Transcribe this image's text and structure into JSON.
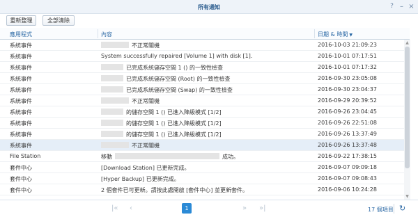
{
  "window": {
    "title": "所有通知",
    "help_icon": "?",
    "minimize_icon": "–",
    "close_icon": "×"
  },
  "toolbar": {
    "reorganize_label": "重新整理",
    "clear_all_label": "全部清除"
  },
  "columns": {
    "app": "應用程式",
    "content": "內容",
    "time": "日期 & 時間",
    "sort_icon": "▼"
  },
  "rows": [
    {
      "app": "系統事件",
      "content": "不正常關機",
      "redacted": "w40",
      "time": "2016-10-03 21:09:23"
    },
    {
      "app": "系統事件",
      "content": "System successfully repaired [Volume 1] with disk [1].",
      "redacted": "",
      "time": "2016-10-01 07:17:51"
    },
    {
      "app": "系統事件",
      "content": "已完成系統儲存空間 1 () 的一致性檢查",
      "redacted": "w32",
      "time": "2016-10-01 07:17:32"
    },
    {
      "app": "系統事件",
      "content": "已完成系統儲存空間 (Root) 的一致性檢查",
      "redacted": "w32",
      "time": "2016-09-30 23:05:08"
    },
    {
      "app": "系統事件",
      "content": "已完成系統儲存空間 (Swap) 的一致性檢查",
      "redacted": "w32",
      "time": "2016-09-30 23:04:37"
    },
    {
      "app": "系統事件",
      "content": "不正常關機",
      "redacted": "w40",
      "time": "2016-09-29 20:39:52"
    },
    {
      "app": "系統事件",
      "content": "的儲存空間 1 () 已進入降級模式 [1/2]",
      "redacted": "w32",
      "time": "2016-09-26 23:04:45"
    },
    {
      "app": "系統事件",
      "content": "的儲存空間 1 () 已進入降級模式 [1/2]",
      "redacted": "w32",
      "time": "2016-09-26 22:51:08"
    },
    {
      "app": "系統事件",
      "content": "的儲存空間 1 () 已進入降級模式 [1/2]",
      "redacted": "w32",
      "time": "2016-09-26 13:37:49"
    },
    {
      "app": "系統事件",
      "content": "不正常關機",
      "redacted": "w40",
      "time": "2016-09-26 13:37:48",
      "selected": true
    },
    {
      "app": "File Station",
      "content": "移動",
      "redacted": "w150",
      "content_after": "成功。",
      "time": "2016-09-22 17:38:15"
    },
    {
      "app": "套件中心",
      "content": "[Download Station] 已更新完成。",
      "redacted": "",
      "time": "2016-09-07 09:09:18"
    },
    {
      "app": "套件中心",
      "content": "[Hyper Backup] 已更新完成。",
      "redacted": "",
      "time": "2016-09-07 09:08:43"
    },
    {
      "app": "套件中心",
      "content": "2 個套件已可更新。請按此處開啟 [套件中心] 並更新套件。",
      "redacted": "",
      "time": "2016-09-06 10:24:28"
    }
  ],
  "pager": {
    "first_icon": "|«",
    "prev_icon": "‹",
    "current_page": "1",
    "next_icon": "»",
    "last_icon": "»|",
    "total_label": "17 個項目",
    "refresh_icon": "↻"
  }
}
